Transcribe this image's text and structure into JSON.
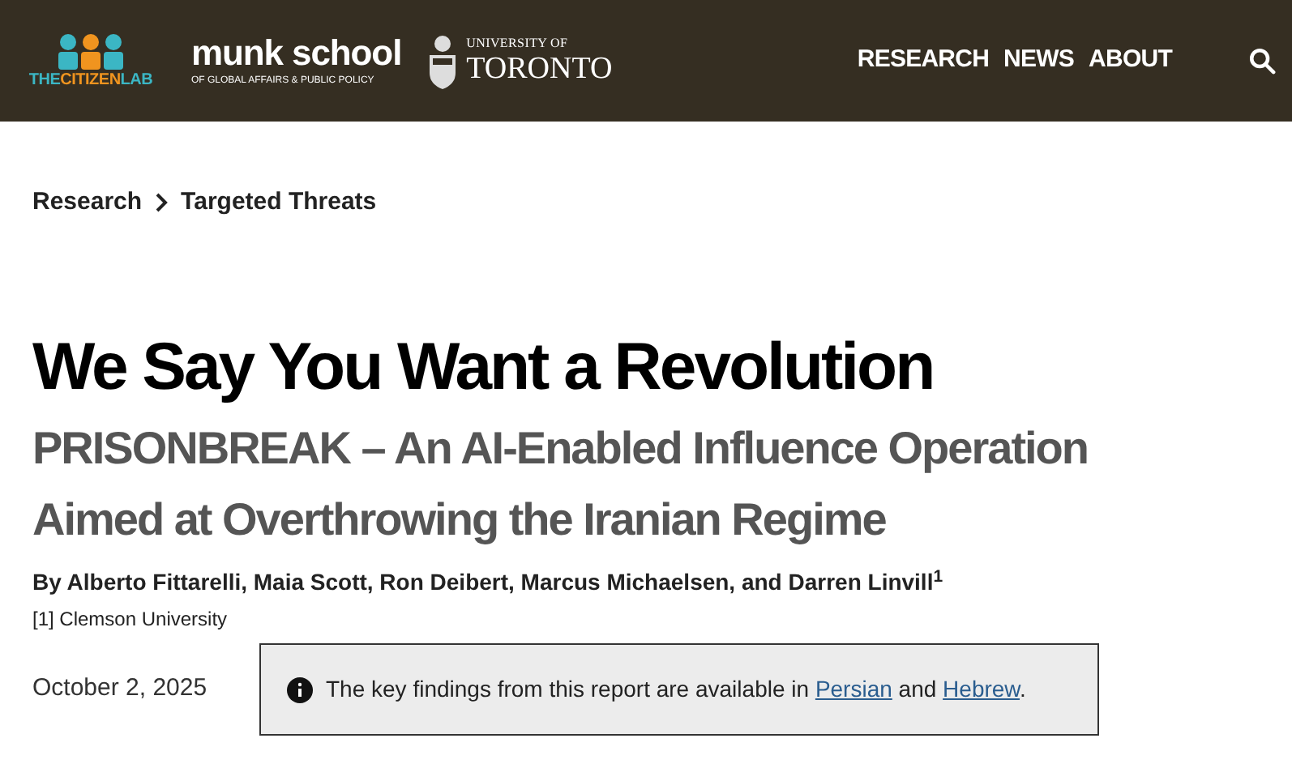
{
  "header": {
    "citizenlab_logo": {
      "parts": [
        {
          "text": "THE",
          "color": "#3bb6c4"
        },
        {
          "text": "CITIZEN",
          "color": "#f0941f"
        },
        {
          "text": "LAB",
          "color": "#3bb6c4"
        }
      ]
    },
    "munk_logo": {
      "name": "munk school",
      "tagline": "OF GLOBAL AFFAIRS & PUBLIC POLICY"
    },
    "uoft_logo": {
      "line1": "UNIVERSITY OF",
      "line2": "TORONTO"
    },
    "nav": [
      {
        "label": "RESEARCH"
      },
      {
        "label": "NEWS"
      },
      {
        "label": "ABOUT"
      }
    ]
  },
  "breadcrumb": [
    "Research",
    "Targeted Threats"
  ],
  "title": "We Say You Want a Revolution",
  "subtitle_lines": [
    "PRISONBREAK – An AI-Enabled Influence Operation",
    "Aimed at Overthrowing the Iranian Regime"
  ],
  "byline": "By Alberto Fittarelli, Maia Scott, Ron Deibert, Marcus Michaelsen, and Darren Linvill$^{1}$",
  "affiliation": "[1] Clemson University",
  "date": "October 2, 2025",
  "notice": {
    "segments": [
      {
        "kind": "text",
        "text": "The key findings from this report are available in "
      },
      {
        "kind": "link",
        "text": "Persian"
      },
      {
        "kind": "text",
        "text": " and "
      },
      {
        "kind": "link",
        "text": "Hebrew"
      },
      {
        "kind": "text",
        "text": "."
      }
    ]
  }
}
